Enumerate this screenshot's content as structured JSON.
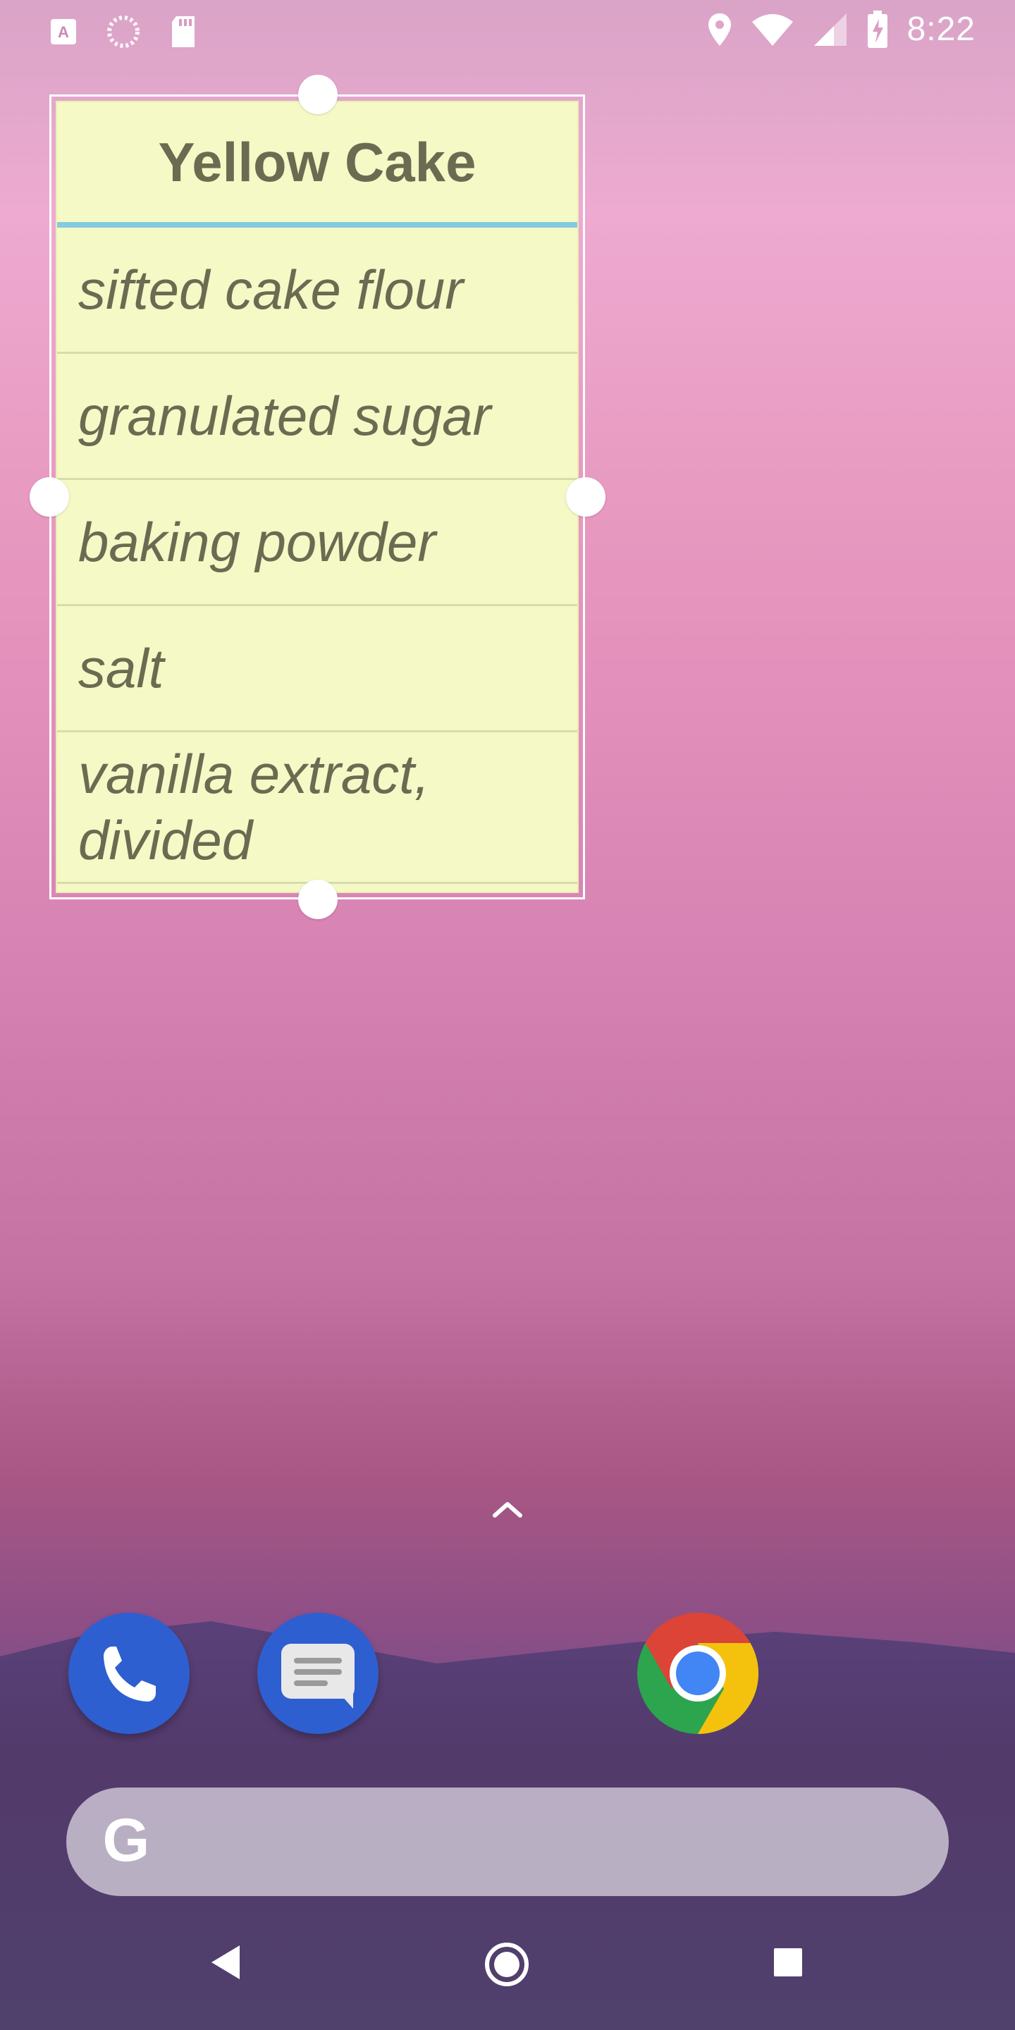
{
  "status_bar": {
    "time": "8:22",
    "left_icons": [
      "accessibility-text-icon",
      "sync-spinner-icon",
      "sd-card-icon"
    ],
    "right_icons": [
      "location-icon",
      "wifi-icon",
      "signal-icon",
      "battery-charging-icon"
    ]
  },
  "note_widget": {
    "title": "Yellow Cake",
    "items": [
      "sifted cake flour",
      "granulated sugar",
      "baking powder",
      "salt",
      "vanilla extract, divided"
    ]
  },
  "dock": {
    "apps": [
      "Phone",
      "Messages",
      "Chrome"
    ]
  },
  "search": {
    "logo": "G"
  },
  "nav": {
    "buttons": [
      "back",
      "home",
      "recents"
    ]
  },
  "colors": {
    "note_background": "#f5f9c6",
    "note_text": "#6b6b52",
    "title_divider": "#86c9e1",
    "app_blue": "#2e5fd0"
  }
}
